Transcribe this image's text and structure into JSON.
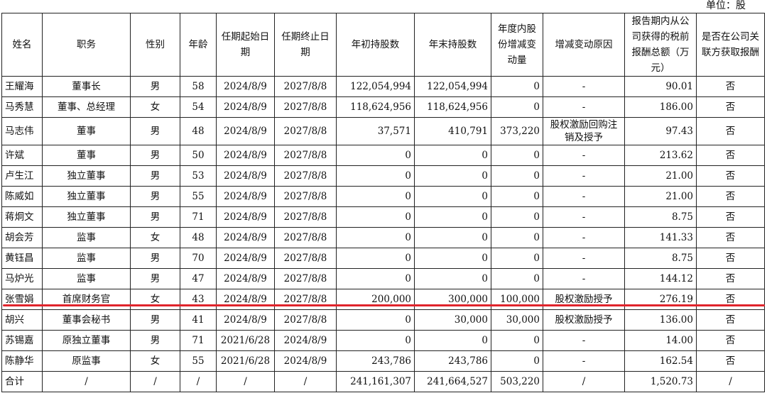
{
  "unit_label": "单位：股",
  "headers": [
    "姓名",
    "职务",
    "性别",
    "年龄",
    "任期起始日期",
    "任期终止日期",
    "年初持股数",
    "年末持股数",
    "年度内股份增减变动量",
    "增减变动原因",
    "报告期内从公司获得的税前报酬总额（万元）",
    "是否在公司关联方获取报酬"
  ],
  "rows": [
    [
      "王耀海",
      "董事长",
      "男",
      "58",
      "2024/8/9",
      "2027/8/8",
      "122,054,994",
      "122,054,994",
      "0",
      "-",
      "90.01",
      "否"
    ],
    [
      "马秀慧",
      "董事、总经理",
      "女",
      "54",
      "2024/8/9",
      "2027/8/8",
      "118,624,956",
      "118,624,956",
      "0",
      "-",
      "186.00",
      "否"
    ],
    [
      "马志伟",
      "董事",
      "男",
      "48",
      "2024/8/9",
      "2027/8/8",
      "37,571",
      "410,791",
      "373,220",
      "股权激励回购注销及授予",
      "97.43",
      "否"
    ],
    [
      "许斌",
      "董事",
      "男",
      "50",
      "2024/8/9",
      "2027/8/8",
      "0",
      "0",
      "0",
      "-",
      "213.62",
      "否"
    ],
    [
      "卢生江",
      "独立董事",
      "男",
      "53",
      "2024/8/9",
      "2027/8/8",
      "0",
      "0",
      "0",
      "-",
      "21.00",
      "否"
    ],
    [
      "陈威如",
      "独立董事",
      "男",
      "55",
      "2024/8/9",
      "2027/8/8",
      "0",
      "0",
      "0",
      "-",
      "21.00",
      "否"
    ],
    [
      "蒋炯文",
      "独立董事",
      "男",
      "71",
      "2024/8/9",
      "2027/8/8",
      "0",
      "0",
      "0",
      "-",
      "8.75",
      "否"
    ],
    [
      "胡会芳",
      "监事",
      "女",
      "48",
      "2024/8/9",
      "2027/8/8",
      "0",
      "0",
      "0",
      "-",
      "141.33",
      "否"
    ],
    [
      "黄钰昌",
      "监事",
      "男",
      "70",
      "2024/8/9",
      "2027/8/8",
      "0",
      "0",
      "0",
      "-",
      "8.75",
      "否"
    ],
    [
      "马炉光",
      "监事",
      "男",
      "47",
      "2024/8/9",
      "2027/8/8",
      "0",
      "0",
      "0",
      "-",
      "144.12",
      "否"
    ],
    [
      "张雪娟",
      "首席财务官",
      "女",
      "43",
      "2024/8/9",
      "2027/8/8",
      "200,000",
      "300,000",
      "100,000",
      "股权激励授予",
      "276.19",
      "否"
    ],
    [
      "胡兴",
      "董事会秘书",
      "男",
      "41",
      "2024/8/9",
      "2027/8/8",
      "0",
      "30,000",
      "30,000",
      "股权激励授予",
      "136.00",
      "否"
    ],
    [
      "苏锡嘉",
      "原独立董事",
      "男",
      "71",
      "2021/6/28",
      "2024/8/9",
      "0",
      "0",
      "0",
      "-",
      "14.00",
      "否"
    ],
    [
      "陈静华",
      "原监事",
      "女",
      "55",
      "2021/6/28",
      "2024/8/9",
      "243,786",
      "243,786",
      "0",
      "-",
      "162.54",
      "否"
    ],
    [
      "合计",
      "/",
      "/",
      "/",
      "/",
      "/",
      "241,161,307",
      "241,664,527",
      "503,220",
      "/",
      "1,520.73",
      "/"
    ]
  ],
  "highlight": {
    "row_index": 10,
    "color": "#e0242c"
  }
}
